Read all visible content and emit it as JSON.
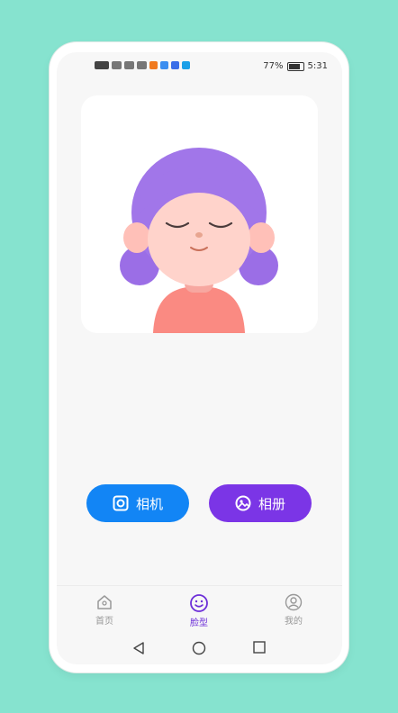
{
  "status_bar": {
    "battery_percent": "77%",
    "time": "5:31"
  },
  "actions": {
    "camera_label": "相机",
    "album_label": "相册"
  },
  "tab_bar": {
    "tabs": [
      {
        "label": "首页",
        "icon": "home-icon",
        "active": false
      },
      {
        "label": "脸型",
        "icon": "smiley-face-icon",
        "active": true
      },
      {
        "label": "我的",
        "icon": "user-profile-icon",
        "active": false
      }
    ],
    "active_color": "#6d2fd8"
  },
  "colors": {
    "background": "#86e3cf",
    "camera_button": "#1285f5",
    "album_button": "#7b35e6"
  }
}
